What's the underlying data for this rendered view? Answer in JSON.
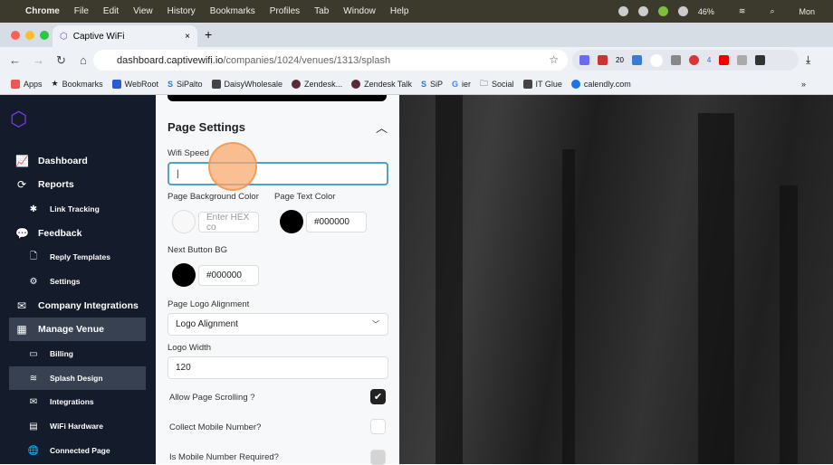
{
  "menubar": {
    "items": [
      "Chrome",
      "File",
      "Edit",
      "View",
      "History",
      "Bookmarks",
      "Profiles",
      "Tab",
      "Window",
      "Help"
    ],
    "battery": "46%",
    "clock": "Mon"
  },
  "browser": {
    "tab_title": "Captive WiFi",
    "tab_close": "×",
    "new_tab": "+",
    "url_host": "dashboard.captivewifi.io",
    "url_path": "/companies/1024/venues/1313/splash",
    "ext_badges": [
      "20",
      "4"
    ]
  },
  "bookmarks": [
    "Apps",
    "Bookmarks",
    "WebRoot",
    "SiPalto",
    "DaisyWholesale",
    "Zendesk...",
    "Zendesk Talk",
    "SiP",
    "ier",
    "Social",
    "IT Glue",
    "calendly.com"
  ],
  "sidebar": {
    "items": [
      {
        "label": "Dashboard",
        "icon": "chart-icon",
        "sub": false
      },
      {
        "label": "Reports",
        "icon": "refresh-icon",
        "sub": false
      },
      {
        "label": "Link Tracking",
        "icon": "link-icon",
        "sub": true
      },
      {
        "label": "Feedback",
        "icon": "chat-icon",
        "sub": false
      },
      {
        "label": "Reply Templates",
        "icon": "file-icon",
        "sub": true
      },
      {
        "label": "Settings",
        "icon": "gear-icon",
        "sub": true
      },
      {
        "label": "Company Integrations",
        "icon": "mail-icon",
        "sub": false
      },
      {
        "label": "Manage Venue",
        "icon": "store-icon",
        "sub": false,
        "active": true
      },
      {
        "label": "Billing",
        "icon": "card-icon",
        "sub": true
      },
      {
        "label": "Splash Design",
        "icon": "wifi-icon",
        "sub": true,
        "active": true
      },
      {
        "label": "Integrations",
        "icon": "mail-icon",
        "sub": true
      },
      {
        "label": "WiFi Hardware",
        "icon": "hardware-icon",
        "sub": true
      },
      {
        "label": "Connected Page",
        "icon": "globe-icon",
        "sub": true
      }
    ]
  },
  "panel": {
    "title": "Page Settings",
    "wifi_speed_label": "Wifi Speed",
    "wifi_speed_value": "|",
    "bg_color_label": "Page Background Color",
    "bg_color_placeholder": "Enter HEX co",
    "text_color_label": "Page Text Color",
    "text_color_value": "#000000",
    "next_btn_label": "Next Button BG",
    "next_btn_value": "#000000",
    "logo_align_label": "Page Logo Alignment",
    "logo_align_value": "Logo Alignment",
    "logo_width_label": "Logo Width",
    "logo_width_value": "120",
    "allow_scroll_label": "Allow Page Scrolling ?",
    "allow_scroll": true,
    "collect_mobile_label": "Collect Mobile Number?",
    "collect_mobile": false,
    "mobile_required_label": "Is Mobile Number Required?",
    "mobile_required": false
  },
  "colors": {
    "sidebar": "#141b2b",
    "accent": "#7c3aed",
    "focus": "#4fa3c7"
  }
}
